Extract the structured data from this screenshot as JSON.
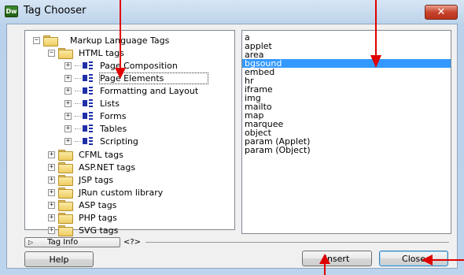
{
  "window": {
    "title": "Tag Chooser",
    "app_icon_text": "Dw",
    "close_glyph": "✕"
  },
  "tree": {
    "root": {
      "label": "Markup Language Tags",
      "expander": "−"
    },
    "html": {
      "label": "HTML tags",
      "expander": "−"
    },
    "html_children": [
      {
        "label": "Page Composition",
        "expander": "+"
      },
      {
        "label": "Page Elements",
        "expander": "+"
      },
      {
        "label": "Formatting and Layout",
        "expander": "+"
      },
      {
        "label": "Lists",
        "expander": "+"
      },
      {
        "label": "Forms",
        "expander": "+"
      },
      {
        "label": "Tables",
        "expander": "+"
      },
      {
        "label": "Scripting",
        "expander": "+"
      }
    ],
    "other_folders": [
      {
        "label": "CFML tags",
        "expander": "+"
      },
      {
        "label": "ASP.NET tags",
        "expander": "+"
      },
      {
        "label": "JSP tags",
        "expander": "+"
      },
      {
        "label": "JRun custom library",
        "expander": "+"
      },
      {
        "label": "ASP tags",
        "expander": "+"
      },
      {
        "label": "PHP tags",
        "expander": "+"
      },
      {
        "label": "SVG tags",
        "expander": "+"
      }
    ],
    "selected_label": "Page Elements"
  },
  "tag_list": {
    "items": [
      "a",
      "applet",
      "area",
      "bgsound",
      "embed",
      "hr",
      "iframe",
      "img",
      "mailto",
      "map",
      "marquee",
      "object",
      "param (Applet)",
      "param (Object)"
    ],
    "selected": "bgsound"
  },
  "tag_info": {
    "arrow_glyph": "▷",
    "label": "Tag Info",
    "code_glyph": "<?>"
  },
  "buttons": {
    "help": "Help",
    "insert": "Insert",
    "close": "Close"
  },
  "colors": {
    "selection": "#3399ff",
    "annotation_arrow": "#e00000"
  }
}
